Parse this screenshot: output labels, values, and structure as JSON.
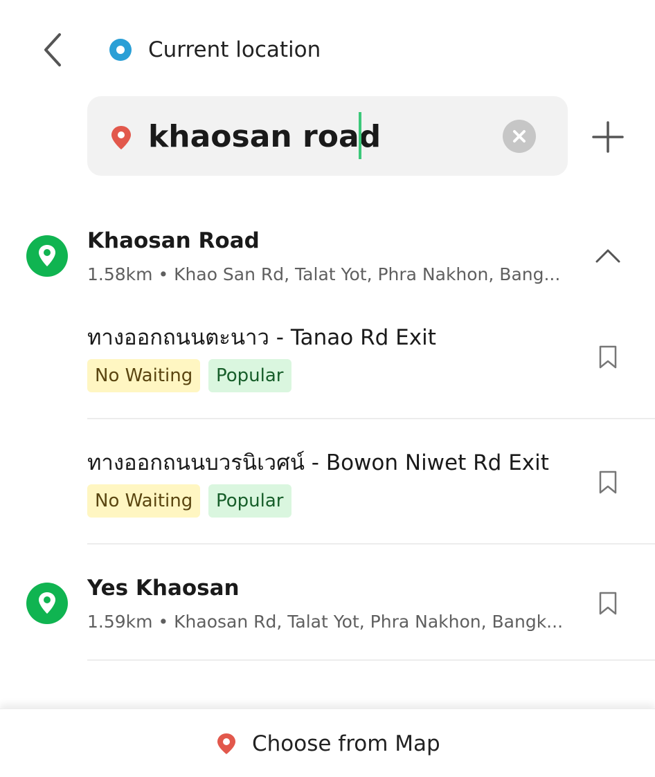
{
  "header": {
    "back_icon": "chevron-left-icon",
    "origin_label": "Current location"
  },
  "search": {
    "value": "khaosan road",
    "clear_icon": "close-circle-icon",
    "add_icon": "plus-icon",
    "pin_color": "#e2584c"
  },
  "results": [
    {
      "title": "Khaosan Road",
      "subtitle": "1.58km • Khao San Rd, Talat Yot, Phra Nakhon, Bang...",
      "action_icon": "chevron-up-icon",
      "sub_items": [
        {
          "title": "ทางออกถนนตะนาว - Tanao Rd Exit",
          "tags": [
            "No Waiting",
            "Popular"
          ]
        },
        {
          "title": "ทางออกถนนบวรนิเวศน์ - Bowon Niwet Rd Exit",
          "tags": [
            "No Waiting",
            "Popular"
          ]
        }
      ]
    },
    {
      "title": "Yes Khaosan",
      "subtitle": "1.59km • Khaosan Rd, Talat Yot, Phra Nakhon, Bangk...",
      "action_icon": "bookmark-icon"
    }
  ],
  "footer": {
    "label": "Choose from Map"
  },
  "colors": {
    "accent_green": "#10b451",
    "location_blue": "#2a9fd6",
    "pin_red": "#e2584c",
    "tag_nowait_bg": "#fff6c2",
    "tag_popular_bg": "#daf6df"
  }
}
